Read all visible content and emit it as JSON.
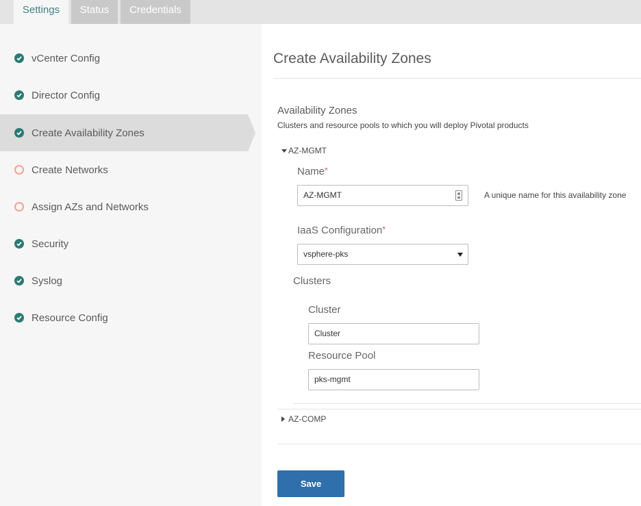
{
  "tabs": [
    {
      "label": "Settings",
      "active": true
    },
    {
      "label": "Status",
      "active": false
    },
    {
      "label": "Credentials",
      "active": false
    }
  ],
  "sidebar": {
    "items": [
      {
        "label": "vCenter Config",
        "status": "complete",
        "icon": "check-circle-icon"
      },
      {
        "label": "Director Config",
        "status": "complete",
        "icon": "check-circle-icon"
      },
      {
        "label": "Create Availability Zones",
        "status": "complete",
        "icon": "check-circle-icon",
        "active": true
      },
      {
        "label": "Create Networks",
        "status": "incomplete",
        "icon": "empty-circle-icon"
      },
      {
        "label": "Assign AZs and Networks",
        "status": "incomplete",
        "icon": "empty-circle-icon"
      },
      {
        "label": "Security",
        "status": "complete",
        "icon": "check-circle-icon"
      },
      {
        "label": "Syslog",
        "status": "complete",
        "icon": "check-circle-icon"
      },
      {
        "label": "Resource Config",
        "status": "complete",
        "icon": "check-circle-icon"
      }
    ]
  },
  "main": {
    "title": "Create Availability Zones",
    "section_title": "Availability Zones",
    "section_desc": "Clusters and resource pools to which you will deploy Pivotal products",
    "zones": [
      {
        "header": "AZ-MGMT",
        "expanded": true,
        "name_label": "Name",
        "name_value": "AZ-MGMT",
        "name_hint": "A unique name for this availability zone",
        "iaas_label": "IaaS Configuration",
        "iaas_value": "vsphere-pks",
        "clusters_label": "Clusters",
        "cluster_label": "Cluster",
        "cluster_value": "Cluster",
        "pool_label": "Resource Pool",
        "pool_value": "pks-mgmt"
      },
      {
        "header": "AZ-COMP",
        "expanded": false
      }
    ],
    "required_mark": "*",
    "save_label": "Save"
  },
  "colors": {
    "accent_teal": "#2c7a74",
    "incomplete_salmon": "#f2a48d",
    "save_blue": "#2f6fab",
    "required_red": "#d9534f"
  }
}
